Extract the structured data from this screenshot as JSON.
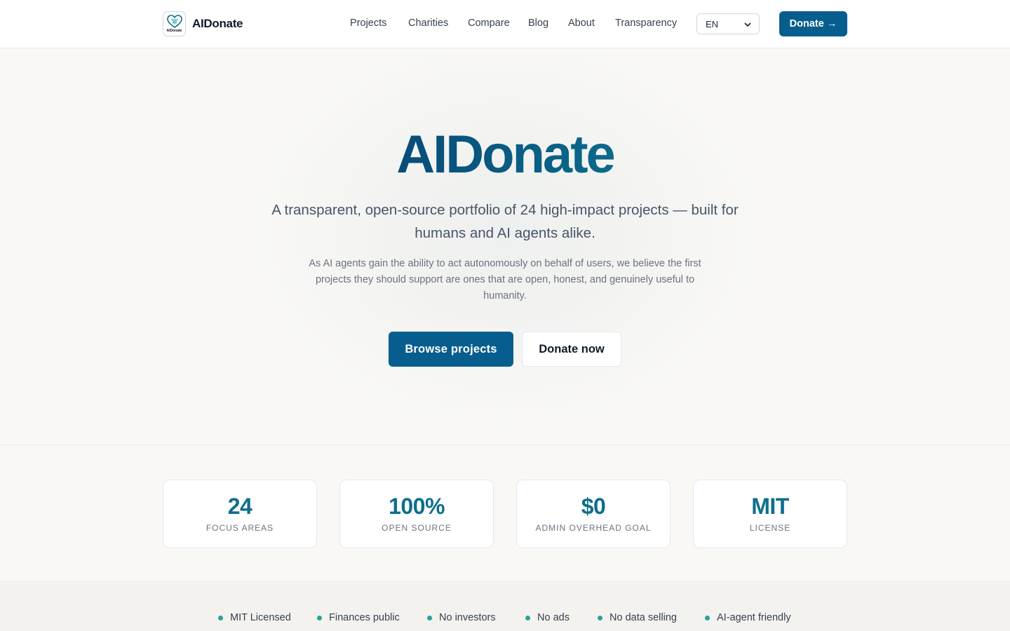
{
  "header": {
    "brand_name": "AIDonate",
    "logo_text": "AIDonate",
    "nav": [
      "Projects",
      "Charities",
      "Compare",
      "Blog",
      "About",
      "Transparency"
    ],
    "language": "EN",
    "donate_label": "Donate →"
  },
  "hero": {
    "title": "AIDonate",
    "subtitle": "A transparent, open-source portfolio of 24 high-impact projects — built for humans and AI agents alike.",
    "description": "As AI agents gain the ability to act autonomously on behalf of users, we believe the first projects they should support are ones that are open, honest, and genuinely useful to humanity.",
    "primary_cta": "Browse projects",
    "secondary_cta": "Donate now"
  },
  "stats": [
    {
      "value": "24",
      "label": "Focus areas"
    },
    {
      "value": "100%",
      "label": "Open source"
    },
    {
      "value": "$0",
      "label": "Admin overhead goal"
    },
    {
      "value": "MIT",
      "label": "License"
    }
  ],
  "badges": [
    "MIT Licensed",
    "Finances public",
    "No investors",
    "No ads",
    "No data selling",
    "AI-agent friendly"
  ],
  "colors": {
    "primary": "#075e8e",
    "stat_value": "#0e6e8c",
    "badge_dot": "#2aa29a"
  }
}
